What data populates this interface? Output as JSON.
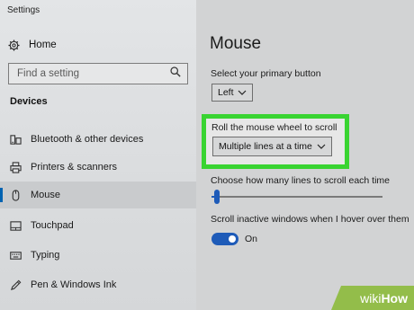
{
  "window": {
    "title": "Settings"
  },
  "sidebar": {
    "home_label": "Home",
    "home_icon": "gear-icon",
    "search_placeholder": "Find a setting",
    "search_icon": "search-icon",
    "section_heading": "Devices",
    "items": [
      {
        "label": "Bluetooth & other devices",
        "icon": "bluetooth-devices-icon"
      },
      {
        "label": "Printers & scanners",
        "icon": "printer-icon"
      },
      {
        "label": "Mouse",
        "icon": "mouse-icon",
        "active": true
      },
      {
        "label": "Touchpad",
        "icon": "touchpad-icon"
      },
      {
        "label": "Typing",
        "icon": "keyboard-icon"
      },
      {
        "label": "Pen & Windows Ink",
        "icon": "pen-icon"
      }
    ]
  },
  "main": {
    "title": "Mouse",
    "primary_button": {
      "label": "Select your primary button",
      "value": "Left"
    },
    "scroll_wheel": {
      "label": "Roll the mouse wheel to scroll",
      "value": "Multiple lines at a time"
    },
    "scroll_lines": {
      "label": "Choose how many lines to scroll each time",
      "level_fraction": 0.03
    },
    "inactive_scroll": {
      "label": "Scroll inactive windows when I hover over them",
      "state": "On",
      "enabled": true
    }
  },
  "watermark": {
    "part1": "wiki",
    "part2": "How"
  },
  "colors": {
    "accent": "#1e5bb8",
    "highlight": "#39d431",
    "watermark": "#93bd4a"
  }
}
